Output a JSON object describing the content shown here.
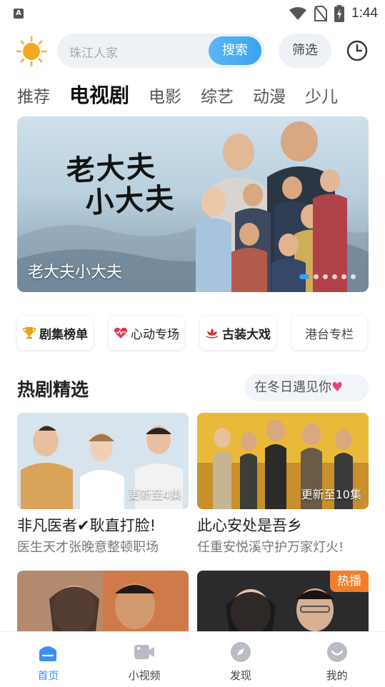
{
  "status_bar": {
    "left_icon": "A",
    "time": "1:44",
    "icons": [
      "wifi-icon",
      "no-sim-icon",
      "battery-charging-icon"
    ]
  },
  "topbar": {
    "weather_icon": "sun-icon",
    "search_placeholder": "珠江人家",
    "search_button": "搜索",
    "filter_button": "筛选",
    "history_icon": "history-icon"
  },
  "tabs": [
    {
      "label": "推荐",
      "active": false
    },
    {
      "label": "电视剧",
      "active": true
    },
    {
      "label": "电影",
      "active": false
    },
    {
      "label": "综艺",
      "active": false
    },
    {
      "label": "动漫",
      "active": false
    },
    {
      "label": "少儿",
      "active": false
    }
  ],
  "banner": {
    "art_title_line1": "老大夫",
    "art_title_line2": "小大夫",
    "caption": "老大夫小大夫",
    "slide_count": 6,
    "active_slide": 1
  },
  "chips": [
    {
      "label": "剧集榜单",
      "icon": "trophy-icon"
    },
    {
      "label": "心动专场",
      "icon": "heart-pulse-icon"
    },
    {
      "label": "古装大戏",
      "icon": "lotus-icon"
    },
    {
      "label": "港台专栏",
      "icon": ""
    }
  ],
  "section": {
    "title": "热剧精选",
    "tag": "在冬日遇见你"
  },
  "cards": [
    {
      "title": "非凡医者✔耿直打脸!",
      "subtitle": "医生天才张晚意整顿职场",
      "badge": "更新至4集"
    },
    {
      "title": "此心安处是吾乡",
      "subtitle": "任重安悦溪守护万家灯火!",
      "badge": "更新至10集"
    },
    {
      "title": "",
      "subtitle": "",
      "badge": ""
    },
    {
      "title": "",
      "subtitle": "",
      "badge": "",
      "hot": "热播"
    }
  ],
  "bottom_nav": [
    {
      "label": "首页",
      "icon": "home-icon",
      "active": true
    },
    {
      "label": "小视频",
      "icon": "video-icon",
      "active": false
    },
    {
      "label": "发现",
      "icon": "compass-icon",
      "active": false
    },
    {
      "label": "我的",
      "icon": "profile-icon",
      "active": false
    }
  ],
  "colors": {
    "accent": "#3aa3f0",
    "nav_active": "#3a8ff0",
    "hot_badge": "#f47d2a",
    "heart": "#e74380"
  }
}
